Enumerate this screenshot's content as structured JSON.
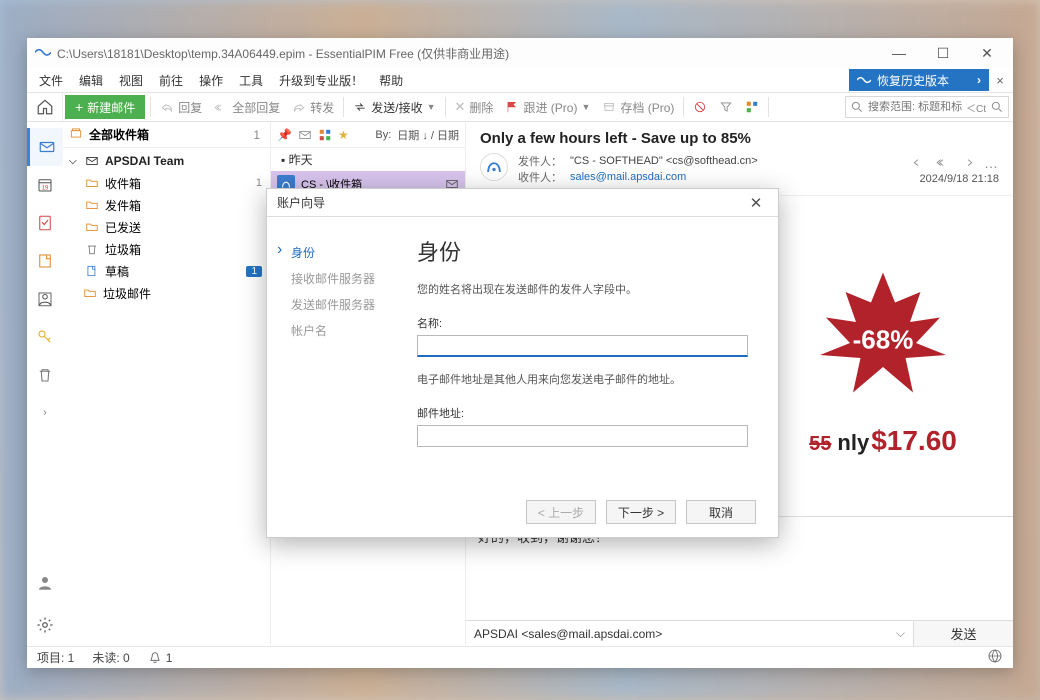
{
  "window": {
    "title": "C:\\Users\\18181\\Desktop\\temp.34A06449.epim - EssentialPIM Free (仅供非商业用途)"
  },
  "menu": {
    "file": "文件",
    "edit": "编辑",
    "view": "视图",
    "go": "前往",
    "operate": "操作",
    "tools": "工具",
    "upgrade": "升级到专业版！",
    "help": "帮助",
    "restore": "恢复历史版本"
  },
  "toolbar": {
    "new_mail": "新建邮件",
    "reply": "回复",
    "reply_all": "全部回复",
    "forward": "转发",
    "sendrecv": "发送/接收",
    "delete": "删除",
    "follow": "跟进 (Pro)",
    "archive": "存档 (Pro)",
    "search_placeholder": "搜索范围: 标题和标签"
  },
  "folders": {
    "all_inbox": "全部收件箱",
    "all_inbox_count": "1",
    "account": "APSDAI Team",
    "inbox": "收件箱",
    "inbox_count": "1",
    "outbox": "发件箱",
    "sent": "已发送",
    "trash": "垃圾箱",
    "drafts": "草稿",
    "drafts_badge": "1",
    "junk": "垃圾邮件"
  },
  "msglist": {
    "sort_by": "By:",
    "sort_val": "日期 ↓ / 日期",
    "group": "昨天",
    "row_sender": "CS - ",
    "row_subject": "\\收件箱"
  },
  "preview": {
    "subject": "Only a few hours left - Save up to 85%",
    "from_label": "发件人：",
    "from_value": "\"CS - SOFTHEAD\" <cs@softhead.cn>",
    "to_label": "收件人：",
    "to_value": "sales@mail.apsdai.com",
    "date": "2024/9/18 21:18",
    "discount": "-68%",
    "old_price": "55",
    "only_label": "nly",
    "new_price": "$17.60",
    "reply_text": "好的，收到，谢谢您！",
    "reply_from": "APSDAI <sales@mail.apsdai.com>",
    "send": "发送"
  },
  "status": {
    "items": "项目: 1",
    "unread": "未读: 0",
    "alerts": "1"
  },
  "dialog": {
    "title": "账户向导",
    "steps": {
      "identity": "身份",
      "recv": "接收邮件服务器",
      "send": "发送邮件服务器",
      "account": "帐户名"
    },
    "heading": "身份",
    "desc1": "您的姓名将出现在发送邮件的发件人字段中。",
    "name_label": "名称:",
    "desc2": "电子邮件地址是其他人用来向您发送电子邮件的地址。",
    "email_label": "邮件地址:",
    "prev": "< 上一步",
    "next": "下一步 >",
    "cancel": "取消"
  }
}
